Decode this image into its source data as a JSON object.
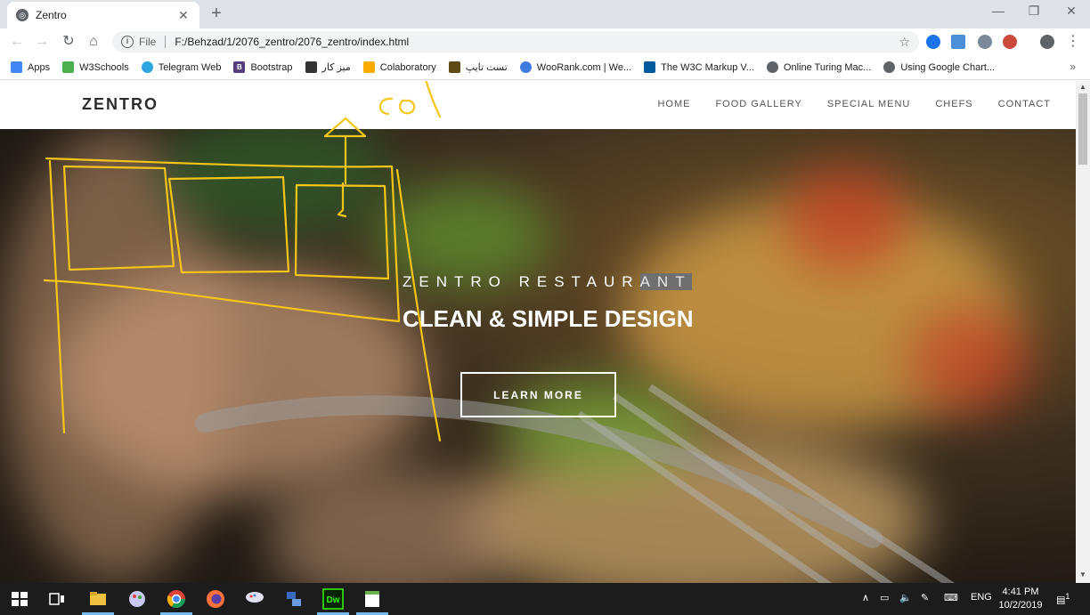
{
  "browser": {
    "tab_title": "Zentro",
    "new_tab_label": "+",
    "window_controls": {
      "minimize": "—",
      "restore": "❐",
      "close": "✕"
    },
    "omnibox": {
      "scheme": "File",
      "url": "F:/Behzad/1/2076_zentro/2076_zentro/index.html"
    },
    "bookmarks": [
      {
        "label": "Apps",
        "icon": "apps-grid-icon",
        "color": "#4285f4"
      },
      {
        "label": "W3Schools",
        "icon": "w3schools-icon",
        "color": "#4caf50"
      },
      {
        "label": "Telegram Web",
        "icon": "telegram-icon",
        "color": "#2ca5e0"
      },
      {
        "label": "Bootstrap",
        "icon": "bootstrap-icon",
        "color": "#563d7c"
      },
      {
        "label": "میز کار",
        "icon": "desk-icon",
        "color": "#333333"
      },
      {
        "label": "Colaboratory",
        "icon": "colab-icon",
        "color": "#f9ab00"
      },
      {
        "label": "تست تایپ",
        "icon": "typing-test-icon",
        "color": "#5d4a16"
      },
      {
        "label": "WooRank.com | We...",
        "icon": "woorank-icon",
        "color": "#3d7be0"
      },
      {
        "label": "The W3C Markup V...",
        "icon": "w3c-icon",
        "color": "#005a9c"
      },
      {
        "label": "Online Turing Mac...",
        "icon": "globe-icon",
        "color": "#5f6368"
      },
      {
        "label": "Using Google Chart...",
        "icon": "globe-icon",
        "color": "#5f6368"
      }
    ],
    "bookmarks_more": "»"
  },
  "site": {
    "brand": "ZENTRO",
    "menu": [
      "HOME",
      "FOOD GALLERY",
      "SPECIAL MENU",
      "CHEFS",
      "CONTACT"
    ],
    "hero": {
      "subtitle_plain": "ZENTRO RESTAUR",
      "subtitle_selected": "ANT",
      "title": "CLEAN & SIMPLE DESIGN",
      "button": "LEARN MORE"
    },
    "annotation": {
      "text": "col",
      "color": "#f5c518"
    }
  },
  "taskbar": {
    "language": "ENG",
    "time": "4:41 PM",
    "date": "10/2/2019",
    "notification_count": "1"
  }
}
